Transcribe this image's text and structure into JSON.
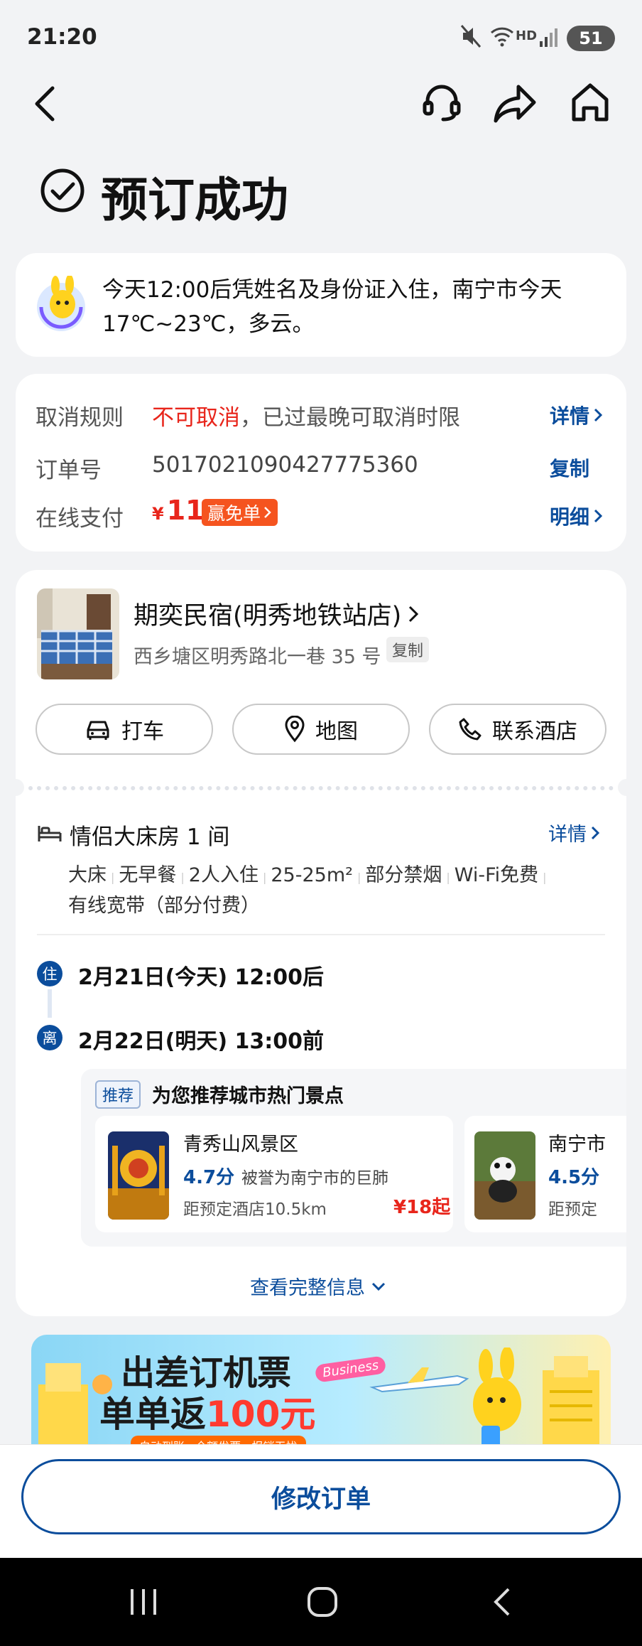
{
  "status_bar": {
    "time": "21:20",
    "network": "HD",
    "battery": "51"
  },
  "nav": {
    "back_icon": "chevron-left-icon",
    "service_icon": "headset-icon",
    "share_icon": "share-icon",
    "home_icon": "home-icon"
  },
  "header": {
    "title": "预订成功"
  },
  "notice": {
    "text": "今天12:00后凭姓名及身份证入住，南宁市今天17℃~23℃，多云。"
  },
  "order": {
    "cancel_label": "取消规则",
    "cancel_status": "不可取消",
    "cancel_note": "，已过最晚可取消时限",
    "cancel_link": "详情",
    "order_label": "订单号",
    "order_no": "5017021090427775360",
    "copy_label": "复制",
    "pay_label": "在线支付",
    "currency": "¥",
    "amount": "11",
    "promo": "赢免单",
    "pay_link": "明细"
  },
  "hotel": {
    "name": "期奕民宿(明秀地铁站店)",
    "address": "西乡塘区明秀路北一巷 35 号",
    "copy_label": "复制",
    "actions": {
      "taxi": "打车",
      "map": "地图",
      "contact": "联系酒店"
    }
  },
  "room": {
    "title": "情侣大床房 1 间",
    "detail_link": "详情",
    "tags": [
      "大床",
      "无早餐",
      "2人入住",
      "25-25m²",
      "部分禁烟",
      "Wi-Fi免费",
      "有线宽带（部分付费）"
    ],
    "checkin_badge": "住",
    "checkin": "2月21日(今天) 12:00后",
    "checkout_badge": "离",
    "checkout": "2月22日(明天) 13:00前"
  },
  "recommend": {
    "badge": "推荐",
    "title": "为您推荐城市热门景点",
    "items": [
      {
        "name": "青秀山风景区",
        "score": "4.7分",
        "desc": "被誉为南宁市的巨肺",
        "distance": "距预定酒店10.5km",
        "price": "¥18起"
      },
      {
        "name": "南宁市",
        "score": "4.5分",
        "desc": "",
        "distance": "距预定",
        "price": ""
      }
    ],
    "more": "查看完整信息"
  },
  "banner": {
    "line1": "出差订机票",
    "line2a": "单单返",
    "line2b": "100元",
    "tag": "Business",
    "foot": "自动到账 · 全额发票 · 报销无忧"
  },
  "footer": {
    "modify": "修改订单"
  },
  "colors": {
    "brand": "#0b4d9c",
    "price": "#e8251b",
    "promo": "#f5541f"
  }
}
